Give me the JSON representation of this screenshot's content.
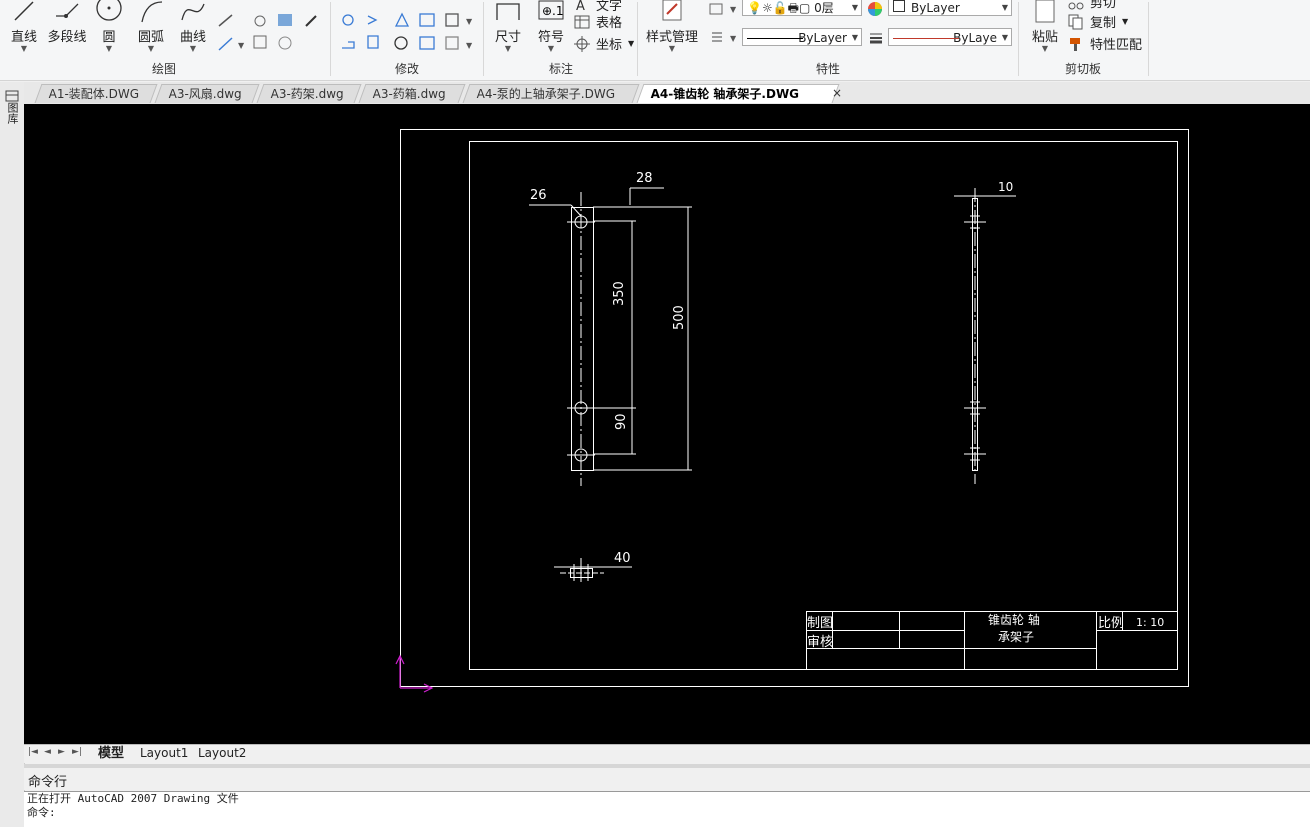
{
  "ribbon": {
    "draw": {
      "label": "绘图",
      "line": "直线",
      "polyline": "多段线",
      "circle": "圆",
      "arc": "圆弧",
      "spline": "曲线"
    },
    "modify": {
      "label": "修改"
    },
    "annotate": {
      "label": "标注",
      "dimension": "尺寸",
      "symbol": "符号",
      "text": "文字",
      "table": "表格",
      "coordinate": "坐标"
    },
    "properties": {
      "label": "特性",
      "style_manager": "样式管理",
      "layer_value": "0层",
      "color_value": "ByLayer",
      "linetype_value": "ByLayer",
      "lineweight_value": "ByLaye"
    },
    "clipboard": {
      "label": "剪切板",
      "paste": "粘贴",
      "cut": "剪切",
      "copy": "复制",
      "match_props": "特性匹配"
    }
  },
  "left_toolbar": {
    "label": "图库"
  },
  "tabs": [
    {
      "label": "A1-装配体.DWG"
    },
    {
      "label": "A3-风扇.dwg"
    },
    {
      "label": "A3-药架.dwg"
    },
    {
      "label": "A3-药箱.dwg"
    },
    {
      "label": "A4-泵的上轴承架子.DWG"
    },
    {
      "label": "A4-锥齿轮  轴承架子.DWG",
      "active": true
    }
  ],
  "tab_close": "×",
  "drawing": {
    "dims": {
      "d26": "26",
      "d28": "28",
      "d350": "350",
      "d500": "500",
      "d90": "90",
      "d10": "10",
      "d40": "40"
    },
    "title_block": {
      "drawn": "制图",
      "review": "审核",
      "part_name_1": "锥齿轮  轴",
      "part_name_2": "承架子",
      "scale_label": "比例",
      "scale_value": "1: 10"
    }
  },
  "layout_tabs": [
    {
      "label": "模型",
      "active": true
    },
    {
      "label": "Layout1"
    },
    {
      "label": "Layout2"
    }
  ],
  "command": {
    "header": "命令行",
    "line1": "正在打开 AutoCAD 2007 Drawing 文件",
    "line2": "命令:"
  }
}
